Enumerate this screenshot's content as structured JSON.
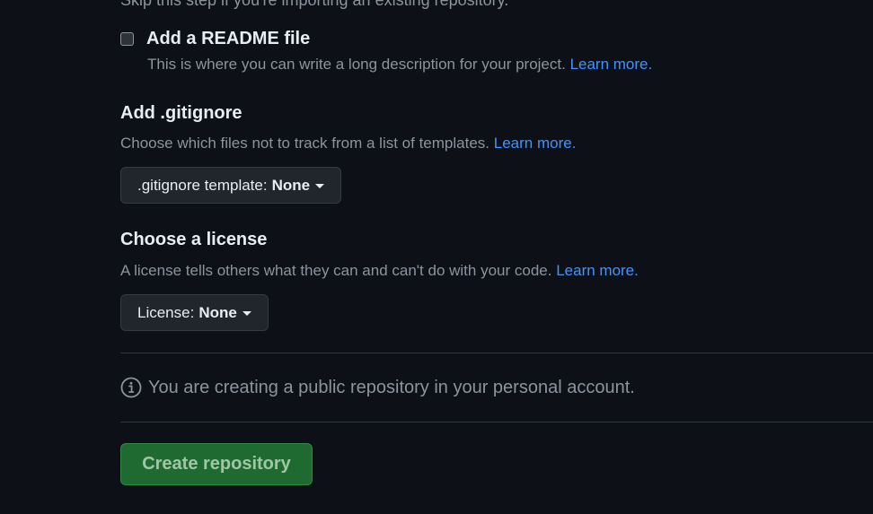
{
  "top_hint": "Skip this step if you're importing an existing repository.",
  "readme": {
    "label": "Add a README file",
    "description": "This is where you can write a long description for your project.",
    "learn_more": "Learn more.",
    "checked": false
  },
  "gitignore": {
    "title": "Add .gitignore",
    "description": "Choose which files not to track from a list of templates.",
    "learn_more": "Learn more.",
    "dropdown_label": ".gitignore template:",
    "dropdown_value": "None"
  },
  "license": {
    "title": "Choose a license",
    "description": "A license tells others what they can and can't do with your code.",
    "learn_more": "Learn more.",
    "dropdown_label": "License:",
    "dropdown_value": "None"
  },
  "info": {
    "icon": "info-icon",
    "message": "You are creating a public repository in your personal account."
  },
  "submit": {
    "label": "Create repository"
  },
  "colors": {
    "background": "#0d1117",
    "link": "#4493f8",
    "button_green": "#1f6a31",
    "muted_text": "#8b949e"
  }
}
